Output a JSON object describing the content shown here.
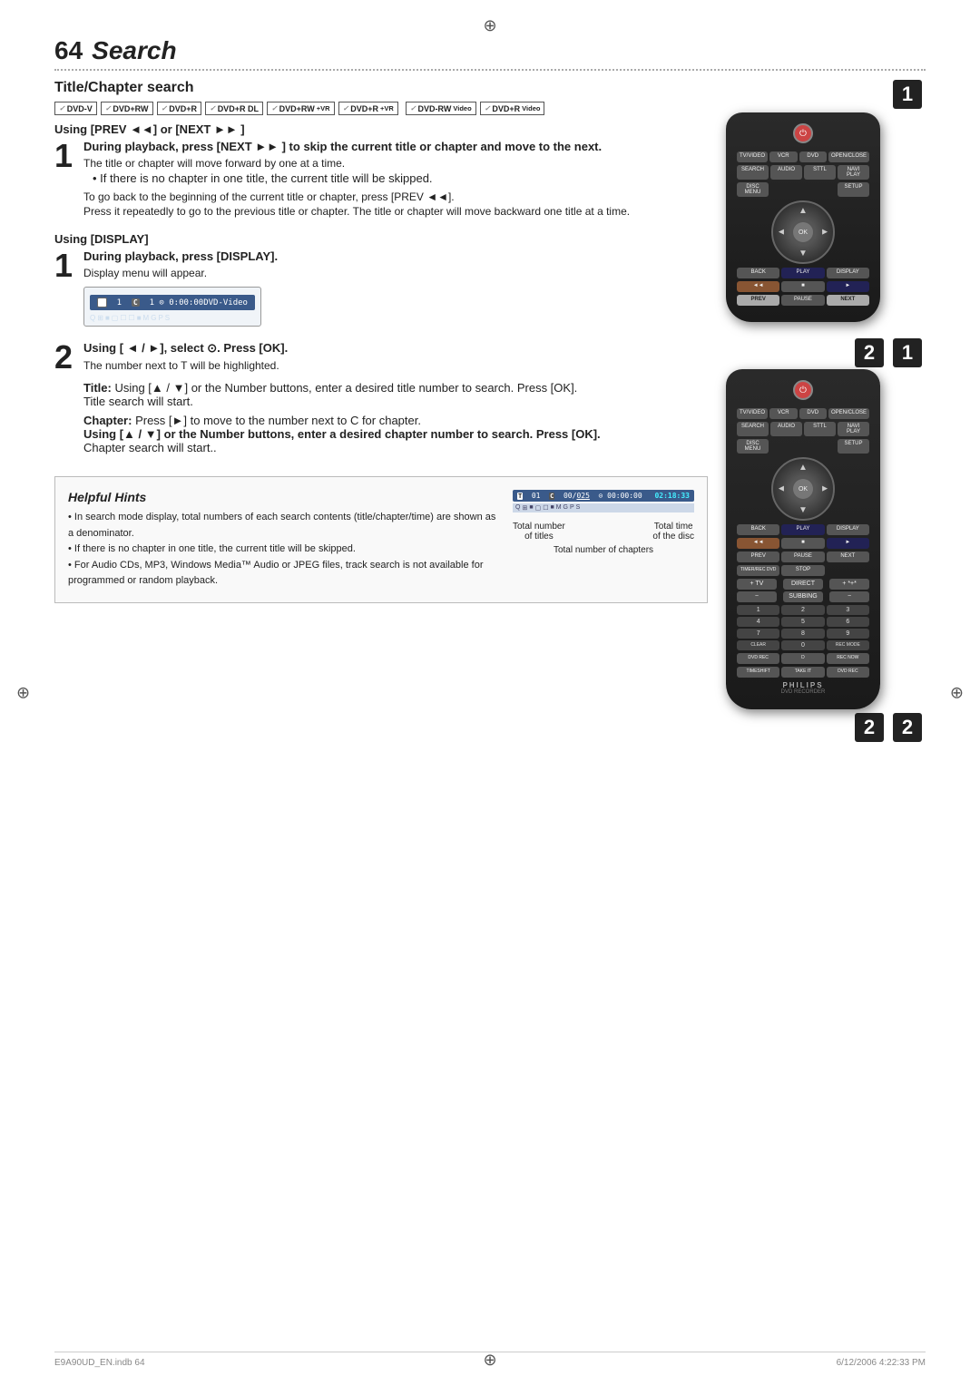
{
  "page": {
    "number": "64",
    "title": "Search",
    "file_info": "E9A90UD_EN.indb  64",
    "date_info": "6/12/2006  4:22:33 PM"
  },
  "section": {
    "title": "Title/Chapter search",
    "formats": [
      "DVD-V",
      "DVD+RW",
      "DVD+R",
      "DVD+R DL",
      "DVD+RW +VR",
      "DVD+R +VR",
      "DVD-RW Video",
      "DVD+R Video"
    ],
    "using_prev_next": {
      "label": "Using [PREV ◄◄] or [NEXT ►► ]",
      "step1": {
        "heading": "During playback, press [NEXT ►► ] to skip the current title or chapter and move to the next.",
        "body1": "The title or chapter will move forward by one at a time.",
        "bullet1": "If there is no chapter in one title, the current title will be skipped.",
        "prev_instruction": "To go back to the beginning of the current title or chapter, press [PREV ◄◄].",
        "prev_detail": "Press it repeatedly to go to the previous title or chapter. The title or chapter will move backward one title at a time."
      }
    },
    "using_display": {
      "label": "Using [DISPLAY]",
      "step1": {
        "heading": "During playback, press [DISPLAY].",
        "body": "Display menu will appear.",
        "display_bar_left": "T 1  C 1  ⊙ 0:00:00",
        "display_bar_right": "DVD-Video",
        "display_icons": "Q ⊞ ■ ▢ ☐ ☐ ■ M G P S"
      },
      "step2": {
        "heading": "Using [ ◄ / ►], select ⊙. Press [OK].",
        "body": "The number next to T will be highlighted.",
        "title_section": {
          "label": "Title:",
          "body": "Using [▲ / ▼] or the Number buttons, enter a desired title number to search. Press [OK].",
          "note": "Title search will start."
        },
        "chapter_section": {
          "label": "Chapter:",
          "body": "Press [►] to move to the number next to C for chapter.",
          "bold_instruction": "Using [▲ / ▼] or the Number buttons, enter a desired chapter number to search. Press [OK].",
          "note": "Chapter search will start.."
        }
      }
    }
  },
  "hints": {
    "title": "Helpful Hints",
    "items": [
      "In search mode display, total numbers of each search contents (title/chapter/time) are shown as a denominator.",
      "If there is no chapter in one title, the current title will be skipped.",
      "For Audio CDs, MP3, Windows Media™ Audio or JPEG files, track search is not available for programmed or random playback."
    ],
    "display_bar_left": "T 01   C 00/025   ⊙ 00:00:00",
    "display_bar_right": "02:18:33",
    "display_icons": "Q ⊞ ■ ▢ ☐ ■ M G P S",
    "label_total_titles": "Total number\nof titles",
    "label_total_chapters": "Total number of chapters",
    "label_total_time": "Total time\nof the disc"
  },
  "remote": {
    "top_buttons": [
      "TV/VIDEO",
      "VCR",
      "DVD",
      "OPEN/CLOSE"
    ],
    "second_row": [
      "SEARCH",
      "AUDIO",
      "STTL",
      "NAVI PLAY"
    ],
    "third_row": [
      "DISC MENU",
      "",
      "",
      "SETUP"
    ],
    "ok_label": "OK",
    "nav_labels": [
      "▲",
      "▼",
      "◄",
      "►"
    ],
    "playback_row": [
      "BACK",
      "PLAY",
      "DISPLAY"
    ],
    "transport_row": [
      "◄◄",
      "■",
      "►"
    ],
    "prev_pause_next": [
      "PREV",
      "PAUSE",
      "NEXT"
    ],
    "rec_row": [
      "TIMER/REC",
      "STOP",
      ""
    ],
    "logo": "PHILIPS",
    "subtitle": "DVD RECORDER",
    "num_pad": [
      "1",
      "2",
      "3",
      "4",
      "5",
      "6",
      "7",
      "8",
      "9",
      "CLEAR",
      "0",
      "REC MODE"
    ]
  }
}
